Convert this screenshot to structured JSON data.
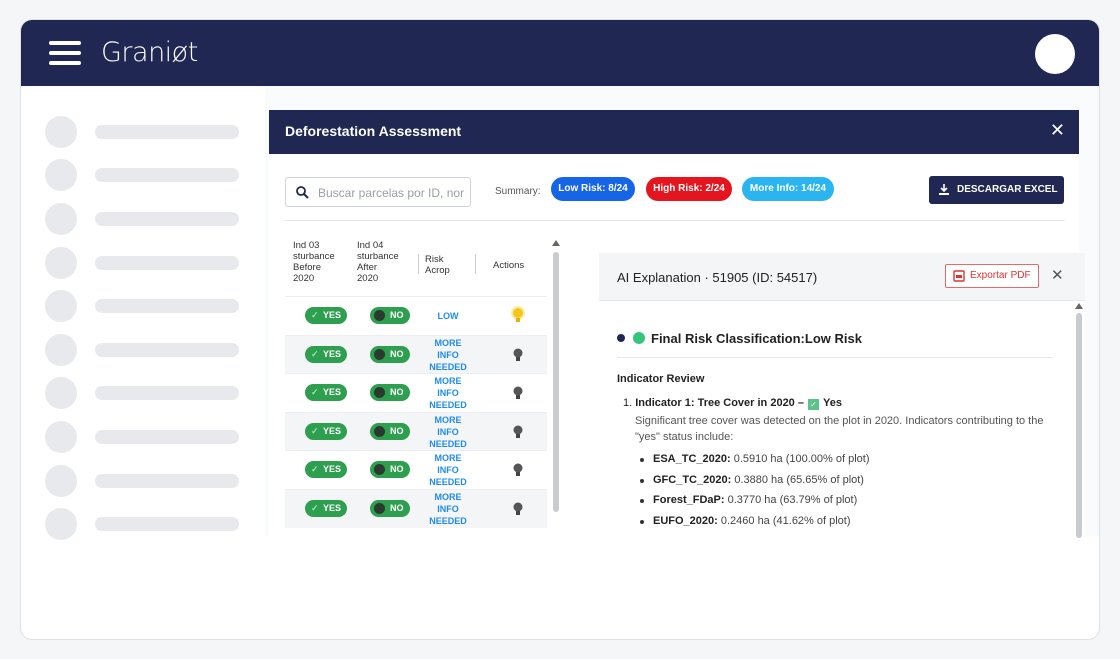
{
  "app": {
    "logo_text": "Graniøt"
  },
  "modal": {
    "title": "Deforestation Assessment",
    "close": "✕",
    "search_placeholder": "Buscar parcelas por ID, nor",
    "summary_label": "Summary:",
    "pills": {
      "low": "Low Risk: 8/24",
      "high": "High Risk: 2/24",
      "info": "More Info: 14/24"
    },
    "excel_button": "DESCARGAR EXCEL",
    "colors": {
      "navy": "#1f2752",
      "low": "#1565e6",
      "high": "#e5151f",
      "info": "#2ab4f0",
      "toggle_green": "#2e9e4f"
    }
  },
  "table": {
    "headers": {
      "ind03": "Ind 03\nsturbance\nBefore\n2020",
      "ind04": "Ind 04\nsturbance\nAfter\n2020",
      "risk": "Risk\nAcrop",
      "actions": "Actions"
    },
    "rows": [
      {
        "ind03": "YES",
        "ind04": "NO",
        "risk": "LOW",
        "bulb": "lit"
      },
      {
        "ind03": "YES",
        "ind04": "NO",
        "risk": "MORE\nINFO\nNEEDED",
        "bulb": "off"
      },
      {
        "ind03": "YES",
        "ind04": "NO",
        "risk": "MORE\nINFO\nNEEDED",
        "bulb": "off"
      },
      {
        "ind03": "YES",
        "ind04": "NO",
        "risk": "MORE\nINFO\nNEEDED",
        "bulb": "off"
      },
      {
        "ind03": "YES",
        "ind04": "NO",
        "risk": "MORE\nINFO\nNEEDED",
        "bulb": "off"
      },
      {
        "ind03": "YES",
        "ind04": "NO",
        "risk": "MORE\nINFO\nNEEDED",
        "bulb": "off"
      }
    ]
  },
  "ai": {
    "title": "AI Explanation · 51905 (ID: 54517)",
    "export_pdf": "Exportar PDF",
    "close": "✕",
    "final_classification": "Final Risk Classification:Low Risk",
    "indicator_review": "Indicator Review",
    "indicator1_prefix": "1. ",
    "indicator1_label": "Indicator 1: Tree Cover in 2020 –",
    "indicator1_value": "Yes",
    "indicator1_desc": "Significant tree cover was detected on the plot in 2020. Indicators contributing to the \"yes\" status include:",
    "bullets": [
      {
        "key": "ESA_TC_2020:",
        "value": " 0.5910 ha (100.00% of plot)"
      },
      {
        "key": "GFC_TC_2020:",
        "value": " 0.3880 ha (65.65% of plot)"
      },
      {
        "key": "Forest_FDaP:",
        "value": " 0.3770 ha (63.79% of plot)"
      },
      {
        "key": "EUFO_2020:",
        "value": " 0.2460 ha (41.62% of plot)"
      }
    ]
  }
}
